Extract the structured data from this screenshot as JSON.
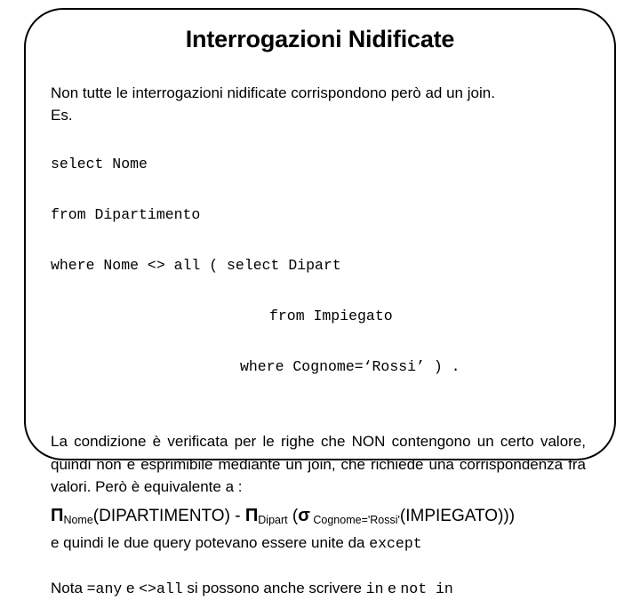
{
  "slide": {
    "title": "Interrogazioni Nidificate",
    "intro_line": "Non tutte le interrogazioni nidificate corrispondono però ad un join.",
    "example_label": "Es.",
    "sql": {
      "line1": "select Nome",
      "line2": "from Dipartimento",
      "line3": "where Nome <> all ( select Dipart",
      "line4": "from Impiegato",
      "line5": "where Cognome=‘Rossi’ ) ."
    },
    "explanation": "La condizione è verificata per le righe che NON contengono un certo valore, quindi non è esprimibile mediante un join, che richiede una corrispondenza fra valori.   Però è equivalente a :",
    "formula": {
      "pi1": "Π",
      "pi1_sub": "Nome",
      "operand1": "(DIPARTIMENTO)",
      "minus": " - ",
      "pi2": "Π",
      "pi2_sub": "Dipart",
      "open_paren": " (",
      "sigma": "σ",
      "sigma_sub": " Cognome='Rossi'",
      "operand2": "(IMPIEGATO)))"
    },
    "conclusion_prefix": "e quindi le due query potevano essere unite da ",
    "conclusion_code": "except",
    "note": {
      "part1": "Nota ",
      "code1": "=any",
      "part2": " e ",
      "code2": "<>all",
      "part3": "  si possono anche scrivere ",
      "code3": "in",
      "part4": " e ",
      "code4": "not in"
    }
  }
}
